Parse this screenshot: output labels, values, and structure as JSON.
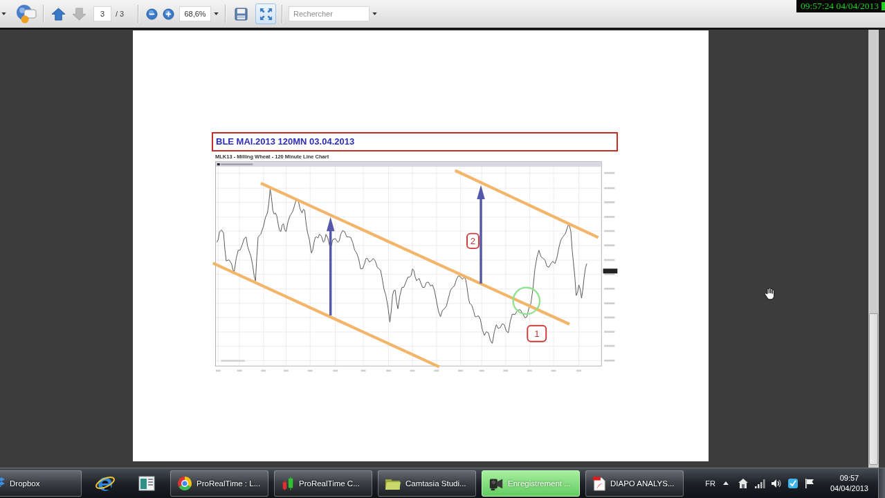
{
  "toolbar": {
    "groups": [
      {
        "items": [
          {
            "kind": "caret",
            "disabled": false,
            "pressed": false
          },
          {
            "kind": "tool",
            "disabled": false,
            "pressed": false
          }
        ]
      },
      {
        "items": [
          {
            "kind": "previous",
            "disabled": false,
            "pressed": false
          },
          {
            "kind": "next",
            "disabled": true,
            "pressed": false
          },
          {
            "kind": "pagefield",
            "value": "3",
            "disabled": false,
            "pressed": false
          },
          {
            "kind": "pagecount",
            "text": "/ 3",
            "disabled": false,
            "pressed": false
          }
        ]
      },
      {
        "items": [
          {
            "kind": "zoomout",
            "disabled": false,
            "pressed": false
          },
          {
            "kind": "zoomin",
            "disabled": false,
            "pressed": false
          },
          {
            "kind": "zoomfield",
            "value": "68,6%",
            "disabled": false,
            "pressed": false
          }
        ]
      },
      {
        "items": [
          {
            "kind": "save",
            "disabled": false,
            "pressed": false
          },
          {
            "kind": "fit",
            "disabled": false,
            "pressed": true
          }
        ]
      },
      {
        "items": [
          {
            "kind": "searchfield",
            "placeholder": "Rechercher",
            "disabled": false,
            "pressed": false
          }
        ]
      }
    ]
  },
  "recording_overlay": {
    "timestamp": "09:57:24 04/04/2013"
  },
  "document": {
    "title": "BLE MAI.2013 120MN 03.04.2013",
    "chart_caption": "MLK13 - Milling Wheat - 120 Minute Line Chart",
    "chart_markers": [
      {
        "label": "2"
      },
      {
        "label": "1"
      }
    ]
  },
  "taskbar": {
    "items": [
      {
        "kind": "window",
        "label": "Dropbox",
        "selected": false
      },
      {
        "kind": "pinned",
        "selected": false
      },
      {
        "kind": "pinned",
        "selected": false
      },
      {
        "kind": "window",
        "label": "ProRealTime : L...",
        "selected": false
      },
      {
        "kind": "window",
        "label": "ProRealTime C...",
        "selected": false
      },
      {
        "kind": "window",
        "label": "Camtasia Studi...",
        "selected": false
      },
      {
        "kind": "window",
        "label": "Enregistrement ...",
        "selected": true
      },
      {
        "kind": "window",
        "label": "DIAPO ANALYS...",
        "selected": false
      }
    ],
    "tray": {
      "language": "FR",
      "time": "09:57",
      "date": "04/04/2013"
    }
  }
}
